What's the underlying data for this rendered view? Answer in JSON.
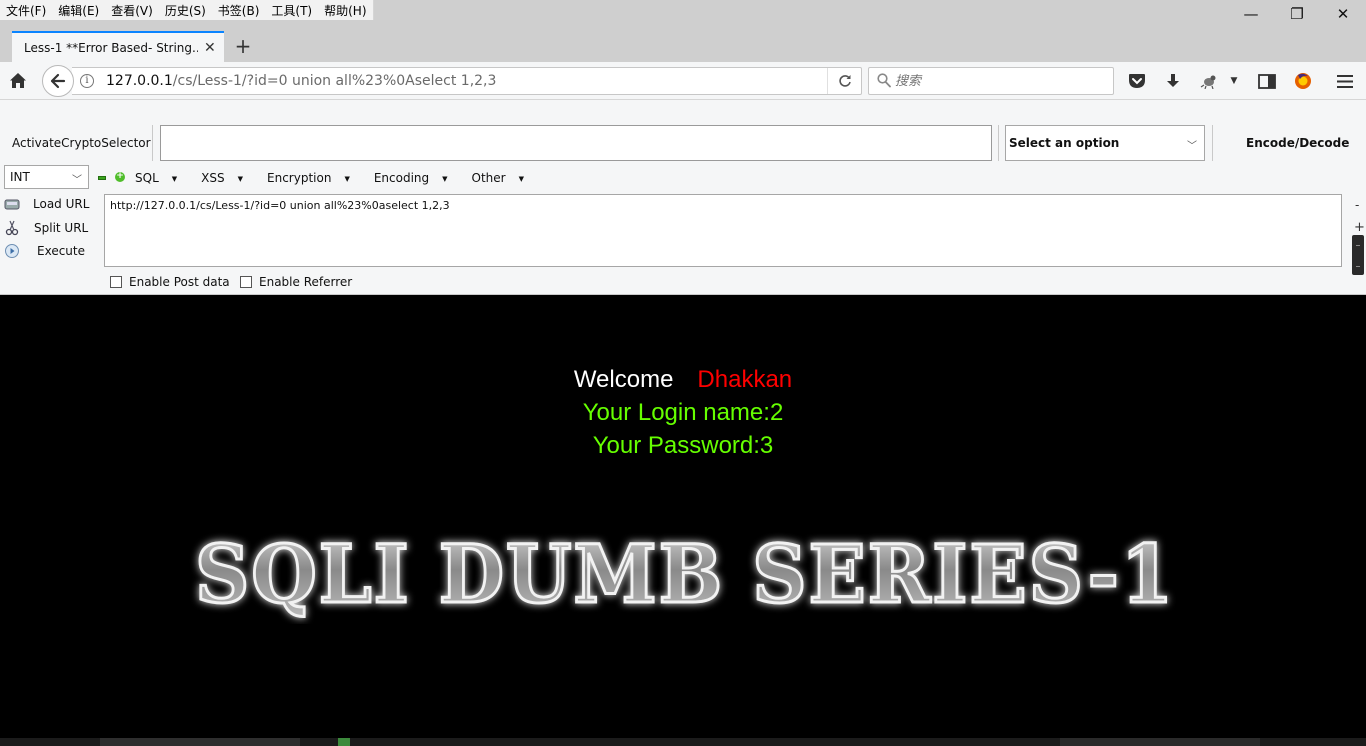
{
  "menubar": {
    "items": [
      "文件(F)",
      "编辑(E)",
      "查看(V)",
      "历史(S)",
      "书签(B)",
      "工具(T)",
      "帮助(H)"
    ]
  },
  "window_controls": {
    "minimize": "—",
    "restore": "❐",
    "close": "✕"
  },
  "tab": {
    "title": "Less-1 **Error Based- String...",
    "close": "✕",
    "new_tab": "+"
  },
  "navbar": {
    "url_host": "127.0.0.1",
    "url_path": "/cs/Less-1/?id=0 union all%23%0Aselect 1,2,3",
    "search_placeholder": "搜索"
  },
  "hackbar": {
    "crypto_label": "ActivateCryptoSelector",
    "crypto_input_value": "",
    "crypto_select_value": "Select an option",
    "encode_decode_label": "Encode/Decode",
    "type_select_value": "INT",
    "menus": [
      "SQL",
      "XSS",
      "Encryption",
      "Encoding",
      "Other"
    ],
    "actions": {
      "load_url": "Load URL",
      "split_url": "Split URL",
      "execute": "Execute"
    },
    "url_value": "http://127.0.0.1/cs/Less-1/?id=0 union all%23%0aselect 1,2,3",
    "enable_post": "Enable Post data",
    "enable_referrer": "Enable Referrer",
    "splitter_minus": "-",
    "splitter_plus": "+"
  },
  "page": {
    "welcome": "Welcome",
    "user": "Dhakkan",
    "login_name": "Your Login name:2",
    "password": "Your Password:3",
    "banner": "SQLI DUMB SERIES-1"
  },
  "colors": {
    "page_bg": "#000000",
    "welcome": "#ffffff",
    "user": "#ff0000",
    "login_text": "#66ff00",
    "tab_accent": "#0a84ff"
  }
}
